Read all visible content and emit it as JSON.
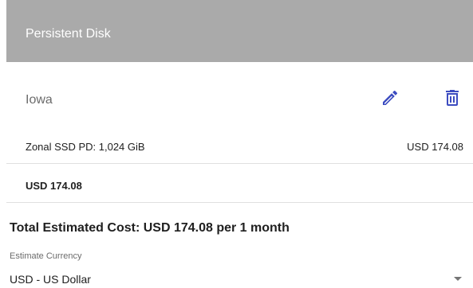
{
  "card": {
    "title": "Persistent Disk",
    "region": "Iowa"
  },
  "icons": {
    "edit": "pencil-icon",
    "delete": "trash-icon",
    "accent_color": "#3c4cc0"
  },
  "line_item": {
    "label": "Zonal SSD PD: 1,024 GiB",
    "price": "USD 174.08"
  },
  "subtotal": "USD 174.08",
  "total": "Total Estimated Cost: USD 174.08 per 1 month",
  "currency": {
    "label": "Estimate Currency",
    "selected": "USD - US Dollar"
  }
}
